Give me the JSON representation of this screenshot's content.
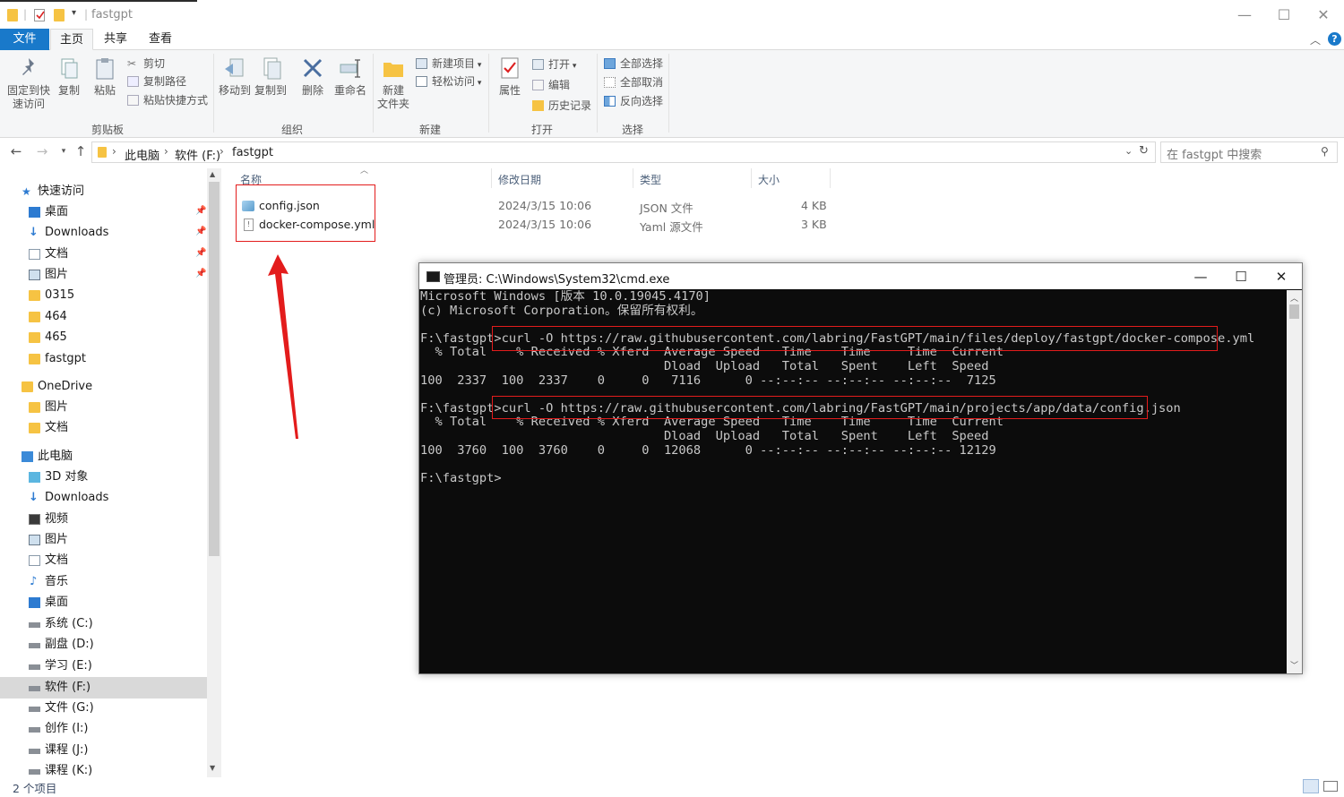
{
  "window": {
    "title": "fastgpt",
    "minimize": "—",
    "maximize": "☐",
    "close": "✕"
  },
  "ribbon_tabs": [
    "文件",
    "主页",
    "共享",
    "查看"
  ],
  "ribbon": {
    "clipboard": {
      "label": "剪贴板",
      "pin_quick_access": "固定到快速访问",
      "pin_line1": "固定到快",
      "pin_line2": "速访问",
      "copy": "复制",
      "paste": "粘贴",
      "cut": "剪切",
      "copy_path": "复制路径",
      "paste_shortcut": "粘贴快捷方式"
    },
    "organize": {
      "label": "组织",
      "move_to": "移动到",
      "copy_to": "复制到",
      "delete": "删除",
      "rename": "重命名"
    },
    "new": {
      "label": "新建",
      "new_folder_line1": "新建",
      "new_folder_line2": "文件夹",
      "new_item": "新建项目",
      "easy_access": "轻松访问"
    },
    "open": {
      "label": "打开",
      "properties": "属性",
      "open": "打开",
      "edit": "编辑",
      "history": "历史记录"
    },
    "select": {
      "label": "选择",
      "select_all": "全部选择",
      "select_none": "全部取消",
      "invert": "反向选择"
    }
  },
  "address": {
    "crumbs": [
      "此电脑",
      "软件 (F:)",
      "fastgpt"
    ],
    "search_placeholder": "在 fastgpt 中搜索"
  },
  "nav": {
    "quick_access": "快速访问",
    "quick_items": [
      {
        "label": "桌面",
        "pinned": true
      },
      {
        "label": "Downloads",
        "pinned": true
      },
      {
        "label": "文档",
        "pinned": true
      },
      {
        "label": "图片",
        "pinned": true
      },
      {
        "label": "0315",
        "pinned": false
      },
      {
        "label": "464",
        "pinned": false
      },
      {
        "label": "465",
        "pinned": false
      },
      {
        "label": "fastgpt",
        "pinned": false
      }
    ],
    "onedrive": "OneDrive",
    "onedrive_items": [
      "图片",
      "文档"
    ],
    "this_pc": "此电脑",
    "pc_items": [
      "3D 对象",
      "Downloads",
      "视频",
      "图片",
      "文档",
      "音乐",
      "桌面",
      "系统 (C:)",
      "副盘 (D:)",
      "学习 (E:)",
      "软件 (F:)",
      "文件 (G:)",
      "创作 (I:)",
      "课程 (J:)",
      "课程 (K:)"
    ],
    "selected": "软件 (F:)"
  },
  "file_list": {
    "columns": {
      "name": "名称",
      "modified": "修改日期",
      "type": "类型",
      "size": "大小"
    },
    "rows": [
      {
        "name": "config.json",
        "modified": "2024/3/15 10:06",
        "type": "JSON 文件",
        "size": "4 KB"
      },
      {
        "name": "docker-compose.yml",
        "modified": "2024/3/15 10:06",
        "type": "Yaml 源文件",
        "size": "3 KB"
      }
    ]
  },
  "cmd": {
    "title": "管理员: C:\\Windows\\System32\\cmd.exe",
    "lines": [
      "Microsoft Windows [版本 10.0.19045.4170]",
      "(c) Microsoft Corporation。保留所有权利。",
      "",
      "F:\\fastgpt>curl -O https://raw.githubusercontent.com/labring/FastGPT/main/files/deploy/fastgpt/docker-compose.yml",
      "  % Total    % Received % Xferd  Average Speed   Time    Time     Time  Current",
      "                                 Dload  Upload   Total   Spent    Left  Speed",
      "100  2337  100  2337    0     0   7116      0 --:--:-- --:--:-- --:--:--  7125",
      "",
      "F:\\fastgpt>curl -O https://raw.githubusercontent.com/labring/FastGPT/main/projects/app/data/config.json",
      "  % Total    % Received % Xferd  Average Speed   Time    Time     Time  Current",
      "                                 Dload  Upload   Total   Spent    Left  Speed",
      "100  3760  100  3760    0     0  12068      0 --:--:-- --:--:-- --:--:-- 12129",
      "",
      "F:\\fastgpt>"
    ]
  },
  "status": {
    "item_count": "2 个项目"
  },
  "colors": {
    "file_tab": "#1979ca",
    "annotation_red": "#e31c1c",
    "console_bg": "#0c0c0c",
    "console_text": "#c8c8c8"
  }
}
